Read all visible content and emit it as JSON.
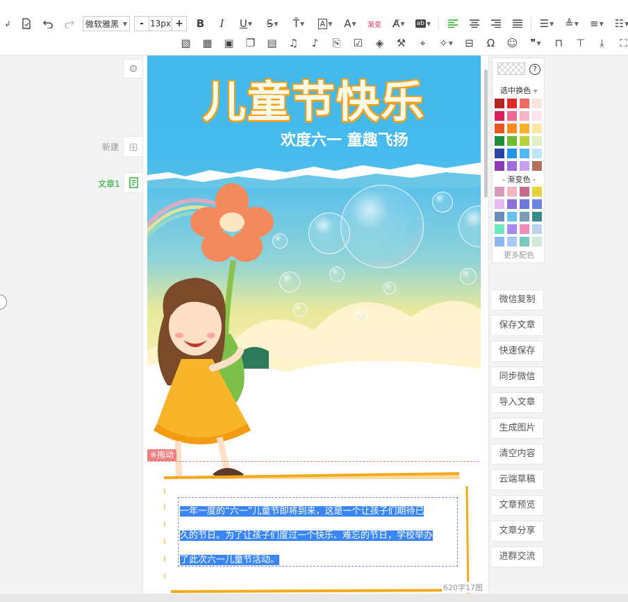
{
  "toolbar": {
    "font_family": "微软雅黑",
    "font_size": "13px",
    "size_minus": "-",
    "size_plus": "+",
    "bold": "B",
    "italic": "I",
    "underline": "U",
    "strike": "S",
    "gradient_label": "渐变",
    "omega": "Ω",
    "quote": "❞"
  },
  "sidebar": {
    "new_label": "新建",
    "article_label": "文章1"
  },
  "editor": {
    "banner_title": "儿童节快乐",
    "banner_subtitle": "欢度六一 童趣飞扬",
    "drag_tag": "※拖动",
    "paragraph_lines": [
      "一年一度的“六一”儿童节即将到来，这是一个让孩子们期待已",
      "久的节日。为了让孩子们度过一个快乐、难忘的节日，学校举办",
      "了此次六一儿童节活动。"
    ],
    "word_count": "620字17图"
  },
  "color_panel": {
    "help": "?",
    "pick_label": "选中换色",
    "gradient_label": "- 渐变色 -",
    "more_label": "更多配色",
    "solid_colors": [
      "#b5251f",
      "#e02b2b",
      "#ee6a5e",
      "#fde3dd",
      "#d81e5b",
      "#ec6a93",
      "#f5b5c8",
      "#fde4ec",
      "#e8551f",
      "#f88a1e",
      "#fbb12a",
      "#fde9a6",
      "#1e8f3a",
      "#6dbb2f",
      "#b7d43a",
      "#e3f0c5",
      "#2c44a5",
      "#2196e8",
      "#52b7f3",
      "#bde6fb",
      "#8a3db6",
      "#a06be0",
      "#c9a0ec",
      "#b5705b"
    ],
    "gradient_colors": [
      "#d59ab5",
      "#f5b6c0",
      "#c56a8a",
      "#e8d23a",
      "#e6b7f0",
      "#8f6fd8",
      "#6d77d8",
      "#6d84e0",
      "#6f8cb8",
      "#66c4ea",
      "#7a9cb6",
      "#3a8c8c",
      "#6fe8c0",
      "#a68af0",
      "#f08ab8",
      "#b8d4ec",
      "#8ab8f0",
      "#a6c8f8",
      "#7ac8c0",
      "#cfe8d8"
    ],
    "accent_color": "#1aad19"
  },
  "right_buttons": [
    "微信复制",
    "保存文章",
    "快速保存",
    "同步微信",
    "导入文章",
    "生成图片",
    "清空内容",
    "云端草稿",
    "文章预览",
    "文章分享",
    "进群交流"
  ]
}
